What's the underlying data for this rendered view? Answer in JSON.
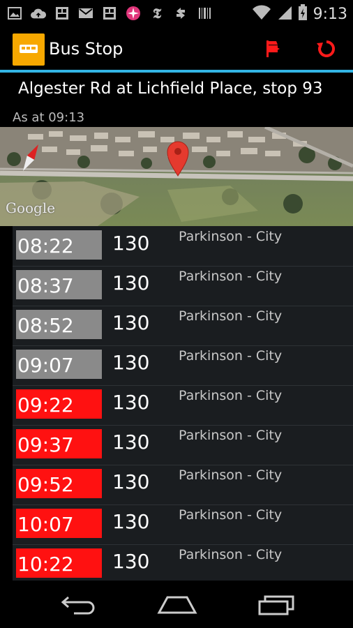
{
  "status_bar": {
    "time": "9:13",
    "icons": [
      "image-icon",
      "cloud-upload-icon",
      "chinese-app-icon",
      "gmail-icon",
      "chinese-app-icon",
      "pinwheel-icon",
      "nytimes-icon",
      "sync-icon",
      "barcode-icon",
      "wifi-icon",
      "signal-icon",
      "battery-icon"
    ]
  },
  "app": {
    "title": "Bus Stop",
    "accent": "#33b5e5",
    "icon_color": "#f7a800",
    "action_color": "#ff1a1a"
  },
  "stop": {
    "name": "Algester Rd at Lichfield Place, stop 93",
    "as_at": "As at 09:13"
  },
  "map": {
    "attribution": "Google"
  },
  "departures": [
    {
      "time": "08:22",
      "route": "130",
      "destination": "Parkinson - City",
      "status": "past"
    },
    {
      "time": "08:37",
      "route": "130",
      "destination": "Parkinson - City",
      "status": "past"
    },
    {
      "time": "08:52",
      "route": "130",
      "destination": "Parkinson - City",
      "status": "past"
    },
    {
      "time": "09:07",
      "route": "130",
      "destination": "Parkinson - City",
      "status": "past"
    },
    {
      "time": "09:22",
      "route": "130",
      "destination": "Parkinson - City",
      "status": "upcoming"
    },
    {
      "time": "09:37",
      "route": "130",
      "destination": "Parkinson - City",
      "status": "upcoming"
    },
    {
      "time": "09:52",
      "route": "130",
      "destination": "Parkinson - City",
      "status": "upcoming"
    },
    {
      "time": "10:07",
      "route": "130",
      "destination": "Parkinson - City",
      "status": "upcoming"
    },
    {
      "time": "10:22",
      "route": "130",
      "destination": "Parkinson - City",
      "status": "upcoming"
    }
  ],
  "status_colors": {
    "past": "#8a8a8a",
    "upcoming": "#ff1111"
  }
}
